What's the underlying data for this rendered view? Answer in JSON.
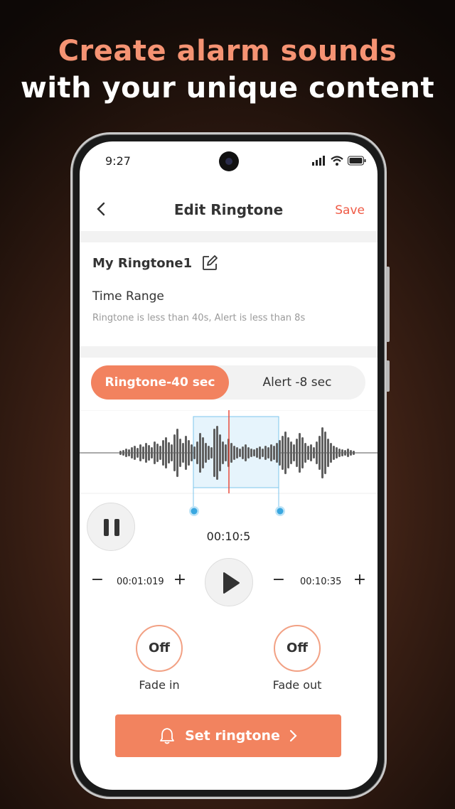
{
  "headline": {
    "line1": "Create alarm sounds",
    "line2": "with your unique content"
  },
  "status_bar": {
    "time": "9:27"
  },
  "nav": {
    "title": "Edit Ringtone",
    "save_label": "Save"
  },
  "ringtone": {
    "name": "My Ringtone1",
    "time_range_label": "Time Range",
    "hint": "Ringtone is less than 40s, Alert is less than 8s"
  },
  "segments": {
    "active": "Ringtone-40 sec",
    "inactive": "Alert -8 sec"
  },
  "player": {
    "current_time": "00:10:5",
    "start_time": "00:01:019",
    "end_time": "00:10:35",
    "minus": "−",
    "plus": "+"
  },
  "fade_in": {
    "state": "Off",
    "label": "Fade in"
  },
  "fade_out": {
    "state": "Off",
    "label": "Fade out"
  },
  "cta": {
    "label": "Set ringtone"
  },
  "colors": {
    "accent": "#f2825f",
    "save": "#ef5a45",
    "selection": "#3aa7e0",
    "playhead": "#e84b3c"
  }
}
